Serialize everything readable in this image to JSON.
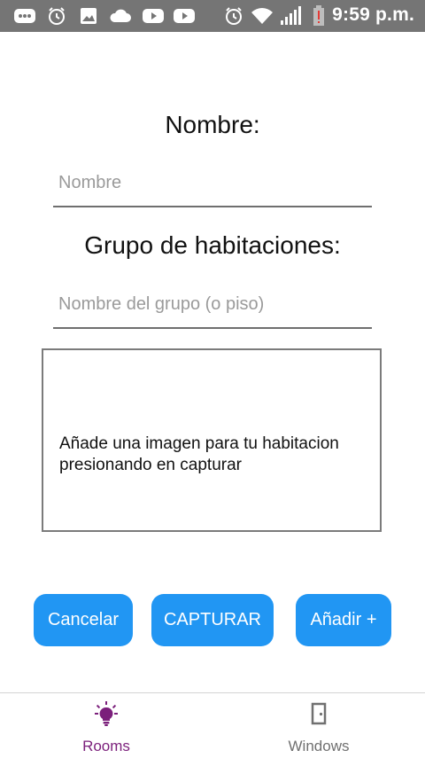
{
  "status_bar": {
    "time": "9:59 p.m.",
    "icons": [
      "message-icon",
      "alarm-icon",
      "image-icon",
      "cloud-icon",
      "youtube-icon",
      "youtube-icon",
      "alarm-icon",
      "wifi-icon",
      "signal-icon",
      "battery-low-icon"
    ]
  },
  "form": {
    "name_title": "Nombre:",
    "name_placeholder": "Nombre",
    "name_value": "",
    "group_title": "Grupo de habitaciones:",
    "group_placeholder": "Nombre del grupo (o piso)",
    "group_value": ""
  },
  "image_box": {
    "text": "Añade una imagen para tu habitacion presionando en capturar"
  },
  "buttons": {
    "cancel": "Cancelar",
    "capture": "CAPTURAR",
    "add": "Añadir +"
  },
  "bottom_nav": {
    "items": [
      {
        "label": "Rooms",
        "icon": "lightbulb-icon",
        "active": true
      },
      {
        "label": "Windows",
        "icon": "door-icon",
        "active": false
      }
    ],
    "active_color": "#7b1f7b",
    "inactive_color": "#707070"
  },
  "colors": {
    "accent": "#2196f3",
    "status_bar": "#757575"
  }
}
